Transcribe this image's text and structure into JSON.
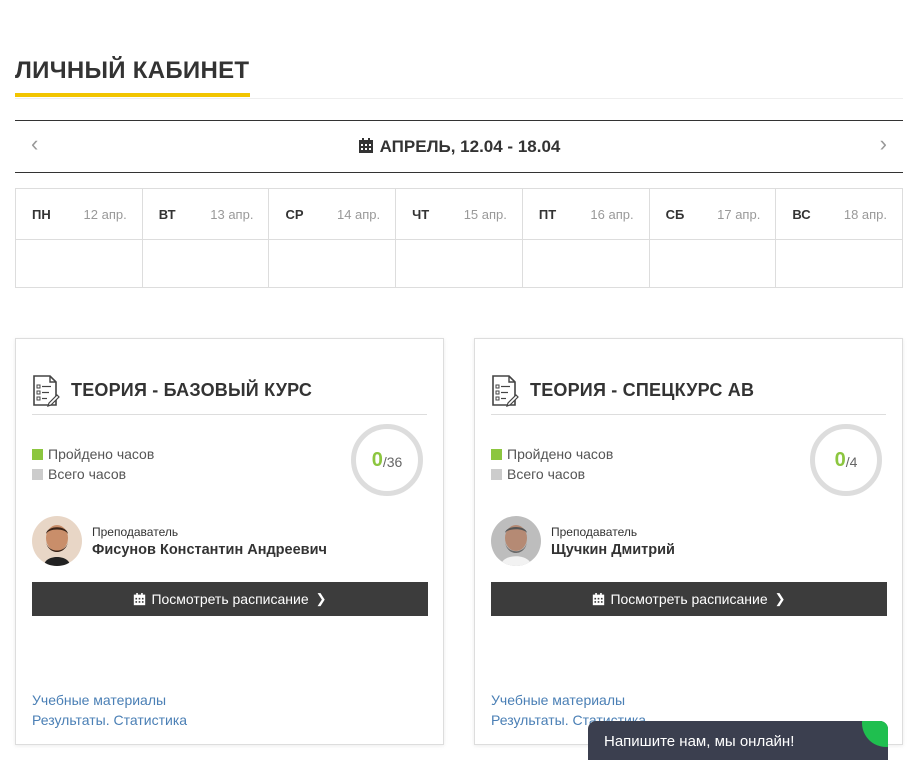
{
  "page": {
    "title": "ЛИЧНЫЙ КАБИНЕТ"
  },
  "week": {
    "prev": "‹",
    "next": "›",
    "label": "АПРЕЛЬ, 12.04 - 18.04"
  },
  "days": [
    {
      "name": "ПН",
      "date": "12 апр."
    },
    {
      "name": "ВТ",
      "date": "13 апр."
    },
    {
      "name": "СР",
      "date": "14 апр."
    },
    {
      "name": "ЧТ",
      "date": "15 апр."
    },
    {
      "name": "ПТ",
      "date": "16 апр."
    },
    {
      "name": "СБ",
      "date": "17 апр."
    },
    {
      "name": "ВС",
      "date": "18 апр."
    }
  ],
  "legend": {
    "done": "Пройдено часов",
    "total": "Всего часов"
  },
  "courses": [
    {
      "title": "ТЕОРИЯ - БАЗОВЫЙ КУРС",
      "done": "0",
      "total": "/36",
      "teacher_label": "Преподаватель",
      "teacher_name": "Фисунов Константин Андреевич",
      "schedule_btn": "Посмотреть расписание",
      "chevron": "❯",
      "link_materials": "Учебные материалы",
      "link_results": "Результаты. Статистика"
    },
    {
      "title": "ТЕОРИЯ - СПЕЦКУРС АВ",
      "done": "0",
      "total": "/4",
      "teacher_label": "Преподаватель",
      "teacher_name": "Щучкин Дмитрий",
      "schedule_btn": "Посмотреть расписание",
      "chevron": "❯",
      "link_materials": "Учебные материалы",
      "link_results": "Результаты. Статистика"
    }
  ],
  "chat": {
    "label": "Напишите нам, мы онлайн!"
  },
  "colors": {
    "accent": "#f2c500",
    "done": "#8cc63f",
    "button": "#3c3c3c",
    "link": "#4a7fb5",
    "chat": "#3b3f4f",
    "online": "#1fbf4f"
  },
  "icons": {
    "calendar": "calendar-icon",
    "document": "document-checklist-icon"
  }
}
